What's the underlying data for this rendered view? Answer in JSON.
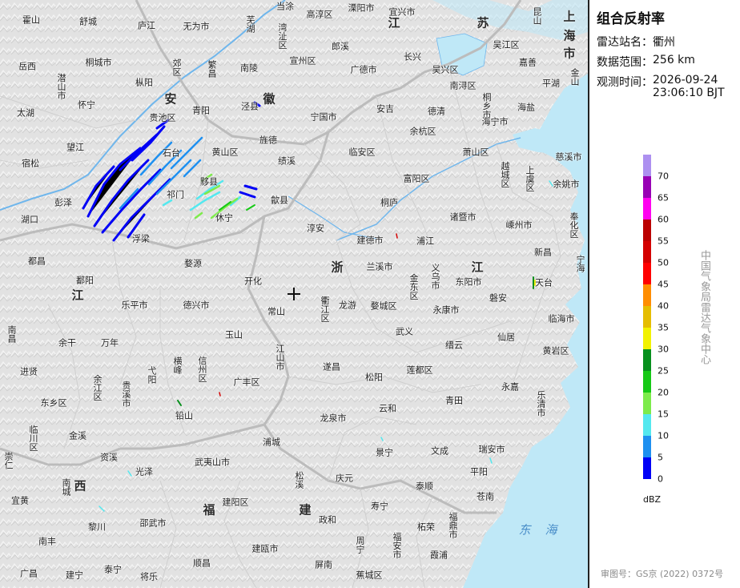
{
  "product": {
    "title": "组合反射率",
    "station_label": "雷达站名：",
    "station": "衢州",
    "range_label": "数据范围：",
    "range": "256 km",
    "time_label": "观测时间：",
    "time_date": "2026-09-24",
    "time_clock": "23:06:10 BJT"
  },
  "legend": {
    "unit": "dBZ",
    "bins": [
      {
        "value": 0,
        "color": "#0000f6"
      },
      {
        "value": 5,
        "color": "#1e90f0"
      },
      {
        "value": 10,
        "color": "#54e8ef"
      },
      {
        "value": 15,
        "color": "#7deb4b"
      },
      {
        "value": 20,
        "color": "#16c916"
      },
      {
        "value": 25,
        "color": "#07901d"
      },
      {
        "value": 30,
        "color": "#f2f200"
      },
      {
        "value": 35,
        "color": "#e5bd00"
      },
      {
        "value": 40,
        "color": "#ff8d00"
      },
      {
        "value": 45,
        "color": "#ff0000"
      },
      {
        "value": 50,
        "color": "#d40000"
      },
      {
        "value": 55,
        "color": "#bb0000"
      },
      {
        "value": 60,
        "color": "#ff00f0"
      },
      {
        "value": 65,
        "color": "#9800b5"
      },
      {
        "value": 70,
        "color": "#ad90f0"
      }
    ]
  },
  "watermark": "中国气象局雷达气象中心",
  "approval": "审图号：GS京 (2022) 0372号",
  "map": {
    "colors": {
      "land": "#e4e4e4",
      "sea": "#bfe8f7",
      "province_border": "#bdbdbd",
      "county_border": "#d2d2d2",
      "river": "#6fb6ec",
      "coast": "#9fcfe6"
    },
    "provinces": [
      {
        "name": "安",
        "pos": [
          213,
          123
        ]
      },
      {
        "name": "徽",
        "pos": [
          336,
          123
        ]
      },
      {
        "name": "江",
        "pos": [
          492,
          28
        ]
      },
      {
        "name": "苏",
        "pos": [
          603,
          28
        ]
      },
      {
        "name": "上",
        "pos": [
          711,
          20
        ]
      },
      {
        "name": "海",
        "pos": [
          711,
          44
        ]
      },
      {
        "name": "市",
        "pos": [
          711,
          66
        ]
      },
      {
        "name": "浙",
        "pos": [
          421,
          333
        ]
      },
      {
        "name": "江",
        "pos": [
          596,
          333
        ]
      },
      {
        "name": "江",
        "pos": [
          97,
          368
        ]
      },
      {
        "name": "西",
        "pos": [
          100,
          606
        ]
      },
      {
        "name": "福",
        "pos": [
          261,
          636
        ]
      },
      {
        "name": "建",
        "pos": [
          381,
          636
        ]
      }
    ],
    "seas": [
      {
        "name": "东",
        "pos": [
          655,
          661
        ]
      },
      {
        "name": "海",
        "pos": [
          688,
          661
        ]
      }
    ],
    "cities": [
      {
        "name": "霍山",
        "pos": [
          39,
          25
        ]
      },
      {
        "name": "舒城",
        "pos": [
          110,
          27
        ]
      },
      {
        "name": "庐江",
        "pos": [
          183,
          32
        ]
      },
      {
        "name": "无为市",
        "pos": [
          245,
          33
        ]
      },
      {
        "name": "芜湖",
        "pos": [
          312,
          30
        ],
        "vertical": true
      },
      {
        "name": "当涂",
        "pos": [
          356,
          8
        ]
      },
      {
        "name": "高淳区",
        "pos": [
          399,
          18
        ]
      },
      {
        "name": "溧阳市",
        "pos": [
          451,
          10
        ]
      },
      {
        "name": "宜兴市",
        "pos": [
          502,
          15
        ]
      },
      {
        "name": "湾沚区",
        "pos": [
          352,
          45
        ],
        "vertical": true
      },
      {
        "name": "郎溪",
        "pos": [
          425,
          58
        ]
      },
      {
        "name": "昆山",
        "pos": [
          670,
          20
        ],
        "vertical": true
      },
      {
        "name": "吴江区",
        "pos": [
          632,
          56
        ]
      },
      {
        "name": "岳西",
        "pos": [
          34,
          83
        ]
      },
      {
        "name": "潜山市",
        "pos": [
          76,
          108
        ],
        "vertical": true
      },
      {
        "name": "桐城市",
        "pos": [
          123,
          78
        ]
      },
      {
        "name": "枞阳",
        "pos": [
          180,
          103
        ]
      },
      {
        "name": "郊区",
        "pos": [
          220,
          84
        ],
        "vertical": true
      },
      {
        "name": "繁昌",
        "pos": [
          264,
          86
        ],
        "vertical": true
      },
      {
        "name": "南陵",
        "pos": [
          311,
          85
        ]
      },
      {
        "name": "宣州区",
        "pos": [
          378,
          76
        ]
      },
      {
        "name": "广德市",
        "pos": [
          454,
          87
        ]
      },
      {
        "name": "长兴",
        "pos": [
          515,
          71
        ]
      },
      {
        "name": "吴兴区",
        "pos": [
          556,
          87
        ]
      },
      {
        "name": "南浔区",
        "pos": [
          578,
          107
        ]
      },
      {
        "name": "嘉善",
        "pos": [
          659,
          78
        ]
      },
      {
        "name": "金山",
        "pos": [
          717,
          96
        ],
        "vertical": true
      },
      {
        "name": "平湖",
        "pos": [
          688,
          104
        ]
      },
      {
        "name": "太湖",
        "pos": [
          32,
          141
        ]
      },
      {
        "name": "怀宁",
        "pos": [
          108,
          131
        ]
      },
      {
        "name": "青阳",
        "pos": [
          251,
          138
        ]
      },
      {
        "name": "泾县",
        "pos": [
          312,
          133
        ]
      },
      {
        "name": "宁国市",
        "pos": [
          404,
          146
        ]
      },
      {
        "name": "安吉",
        "pos": [
          481,
          136
        ]
      },
      {
        "name": "德清",
        "pos": [
          545,
          139
        ]
      },
      {
        "name": "桐乡市",
        "pos": [
          607,
          132
        ],
        "vertical": true
      },
      {
        "name": "海宁市",
        "pos": [
          618,
          152
        ]
      },
      {
        "name": "海盐",
        "pos": [
          657,
          134
        ]
      },
      {
        "name": "贵池区",
        "pos": [
          203,
          147
        ]
      },
      {
        "name": "石台",
        "pos": [
          214,
          191
        ]
      },
      {
        "name": "黄山区",
        "pos": [
          281,
          190
        ]
      },
      {
        "name": "旌德",
        "pos": [
          335,
          175
        ]
      },
      {
        "name": "绩溪",
        "pos": [
          358,
          201
        ]
      },
      {
        "name": "临安区",
        "pos": [
          452,
          190
        ]
      },
      {
        "name": "余杭区",
        "pos": [
          528,
          164
        ]
      },
      {
        "name": "萧山区",
        "pos": [
          594,
          190
        ]
      },
      {
        "name": "慈溪市",
        "pos": [
          710,
          196
        ]
      },
      {
        "name": "望江",
        "pos": [
          94,
          184
        ]
      },
      {
        "name": "宿松",
        "pos": [
          38,
          204
        ]
      },
      {
        "name": "富阳区",
        "pos": [
          520,
          223
        ]
      },
      {
        "name": "越城区",
        "pos": [
          630,
          218
        ],
        "vertical": true
      },
      {
        "name": "上虞区",
        "pos": [
          661,
          223
        ],
        "vertical": true
      },
      {
        "name": "余姚市",
        "pos": [
          707,
          230
        ]
      },
      {
        "name": "彭泽",
        "pos": [
          79,
          253
        ]
      },
      {
        "name": "祁门",
        "pos": [
          219,
          243
        ]
      },
      {
        "name": "黟县",
        "pos": [
          261,
          227
        ]
      },
      {
        "name": "休宁",
        "pos": [
          280,
          272
        ]
      },
      {
        "name": "歙县",
        "pos": [
          349,
          250
        ]
      },
      {
        "name": "桐庐",
        "pos": [
          486,
          253
        ]
      },
      {
        "name": "诸暨市",
        "pos": [
          578,
          271
        ]
      },
      {
        "name": "嵊州市",
        "pos": [
          648,
          281
        ]
      },
      {
        "name": "奉化区",
        "pos": [
          716,
          281
        ],
        "vertical": true
      },
      {
        "name": "湖口",
        "pos": [
          37,
          274
        ]
      },
      {
        "name": "浮梁",
        "pos": [
          176,
          298
        ]
      },
      {
        "name": "淳安",
        "pos": [
          394,
          285
        ]
      },
      {
        "name": "建德市",
        "pos": [
          462,
          300
        ]
      },
      {
        "name": "浦江",
        "pos": [
          531,
          301
        ]
      },
      {
        "name": "新昌",
        "pos": [
          678,
          315
        ]
      },
      {
        "name": "宁海",
        "pos": [
          724,
          329
        ],
        "vertical": true
      },
      {
        "name": "都昌",
        "pos": [
          46,
          326
        ]
      },
      {
        "name": "婺源",
        "pos": [
          241,
          329
        ]
      },
      {
        "name": "开化",
        "pos": [
          316,
          351
        ]
      },
      {
        "name": "兰溪市",
        "pos": [
          474,
          333
        ]
      },
      {
        "name": "金东区",
        "pos": [
          516,
          358
        ],
        "vertical": true
      },
      {
        "name": "义乌市",
        "pos": [
          543,
          345
        ],
        "vertical": true
      },
      {
        "name": "东阳市",
        "pos": [
          585,
          352
        ]
      },
      {
        "name": "天台",
        "pos": [
          679,
          353
        ]
      },
      {
        "name": "鄱阳",
        "pos": [
          106,
          350
        ]
      },
      {
        "name": "乐平市",
        "pos": [
          168,
          381
        ]
      },
      {
        "name": "德兴市",
        "pos": [
          245,
          381
        ]
      },
      {
        "name": "常山",
        "pos": [
          345,
          389
        ]
      },
      {
        "name": "衢江区",
        "pos": [
          405,
          386
        ],
        "vertical": true
      },
      {
        "name": "龙游",
        "pos": [
          434,
          381
        ]
      },
      {
        "name": "婺城区",
        "pos": [
          479,
          382
        ]
      },
      {
        "name": "永康市",
        "pos": [
          557,
          387
        ]
      },
      {
        "name": "磐安",
        "pos": [
          622,
          372
        ]
      },
      {
        "name": "临海市",
        "pos": [
          701,
          398
        ]
      },
      {
        "name": "南昌",
        "pos": [
          14,
          417
        ],
        "vertical": true
      },
      {
        "name": "余干",
        "pos": [
          84,
          428
        ]
      },
      {
        "name": "万年",
        "pos": [
          137,
          428
        ]
      },
      {
        "name": "玉山",
        "pos": [
          292,
          418
        ]
      },
      {
        "name": "武义",
        "pos": [
          505,
          414
        ]
      },
      {
        "name": "仙居",
        "pos": [
          632,
          421
        ]
      },
      {
        "name": "江山市",
        "pos": [
          349,
          446
        ],
        "vertical": true
      },
      {
        "name": "缙云",
        "pos": [
          567,
          431
        ]
      },
      {
        "name": "黄岩区",
        "pos": [
          694,
          438
        ]
      },
      {
        "name": "弋阳",
        "pos": [
          189,
          468
        ],
        "vertical": true
      },
      {
        "name": "横峰",
        "pos": [
          221,
          456
        ],
        "vertical": true
      },
      {
        "name": "信州区",
        "pos": [
          252,
          461
        ],
        "vertical": true
      },
      {
        "name": "遂昌",
        "pos": [
          414,
          458
        ]
      },
      {
        "name": "莲都区",
        "pos": [
          524,
          462
        ]
      },
      {
        "name": "进贤",
        "pos": [
          36,
          464
        ]
      },
      {
        "name": "余江区",
        "pos": [
          121,
          484
        ],
        "vertical": true
      },
      {
        "name": "贵溪市",
        "pos": [
          157,
          492
        ],
        "vertical": true
      },
      {
        "name": "广丰区",
        "pos": [
          308,
          477
        ]
      },
      {
        "name": "松阳",
        "pos": [
          467,
          471
        ]
      },
      {
        "name": "永嘉",
        "pos": [
          637,
          483
        ]
      },
      {
        "name": "东乡区",
        "pos": [
          67,
          503
        ]
      },
      {
        "name": "铅山",
        "pos": [
          230,
          519
        ]
      },
      {
        "name": "云和",
        "pos": [
          484,
          510
        ]
      },
      {
        "name": "青田",
        "pos": [
          567,
          500
        ]
      },
      {
        "name": "乐清市",
        "pos": [
          675,
          504
        ],
        "vertical": true
      },
      {
        "name": "临川区",
        "pos": [
          41,
          547
        ],
        "vertical": true
      },
      {
        "name": "金溪",
        "pos": [
          97,
          544
        ]
      },
      {
        "name": "龙泉市",
        "pos": [
          416,
          522
        ]
      },
      {
        "name": "浦城",
        "pos": [
          339,
          552
        ]
      },
      {
        "name": "景宁",
        "pos": [
          480,
          565
        ]
      },
      {
        "name": "文成",
        "pos": [
          549,
          563
        ]
      },
      {
        "name": "瑞安市",
        "pos": [
          614,
          561
        ]
      },
      {
        "name": "崇仁",
        "pos": [
          10,
          575
        ],
        "vertical": true
      },
      {
        "name": "资溪",
        "pos": [
          136,
          571
        ]
      },
      {
        "name": "光泽",
        "pos": [
          180,
          589
        ]
      },
      {
        "name": "武夷山市",
        "pos": [
          265,
          577
        ]
      },
      {
        "name": "松溪",
        "pos": [
          373,
          599
        ],
        "vertical": true
      },
      {
        "name": "庆元",
        "pos": [
          430,
          597
        ]
      },
      {
        "name": "泰顺",
        "pos": [
          530,
          607
        ]
      },
      {
        "name": "平阳",
        "pos": [
          598,
          589
        ]
      },
      {
        "name": "南城",
        "pos": [
          82,
          608
        ],
        "vertical": true
      },
      {
        "name": "宜黄",
        "pos": [
          25,
          625
        ]
      },
      {
        "name": "苍南",
        "pos": [
          606,
          620
        ]
      },
      {
        "name": "建阳区",
        "pos": [
          294,
          627
        ]
      },
      {
        "name": "寿宁",
        "pos": [
          474,
          632
        ]
      },
      {
        "name": "黎川",
        "pos": [
          121,
          658
        ]
      },
      {
        "name": "邵武市",
        "pos": [
          191,
          653
        ]
      },
      {
        "name": "政和",
        "pos": [
          409,
          649
        ]
      },
      {
        "name": "柘荣",
        "pos": [
          532,
          658
        ]
      },
      {
        "name": "福鼎市",
        "pos": [
          565,
          656
        ],
        "vertical": true
      },
      {
        "name": "南丰",
        "pos": [
          59,
          676
        ]
      },
      {
        "name": "周宁",
        "pos": [
          449,
          680
        ],
        "vertical": true
      },
      {
        "name": "福安市",
        "pos": [
          495,
          681
        ],
        "vertical": true
      },
      {
        "name": "建瓯市",
        "pos": [
          331,
          685
        ]
      },
      {
        "name": "霞浦",
        "pos": [
          548,
          693
        ]
      },
      {
        "name": "广昌",
        "pos": [
          36,
          716
        ]
      },
      {
        "name": "建宁",
        "pos": [
          93,
          718
        ]
      },
      {
        "name": "泰宁",
        "pos": [
          141,
          711
        ]
      },
      {
        "name": "将乐",
        "pos": [
          186,
          720
        ]
      },
      {
        "name": "顺昌",
        "pos": [
          252,
          703
        ]
      },
      {
        "name": "屏南",
        "pos": [
          404,
          705
        ]
      },
      {
        "name": "蕉城区",
        "pos": [
          461,
          718
        ]
      }
    ]
  }
}
